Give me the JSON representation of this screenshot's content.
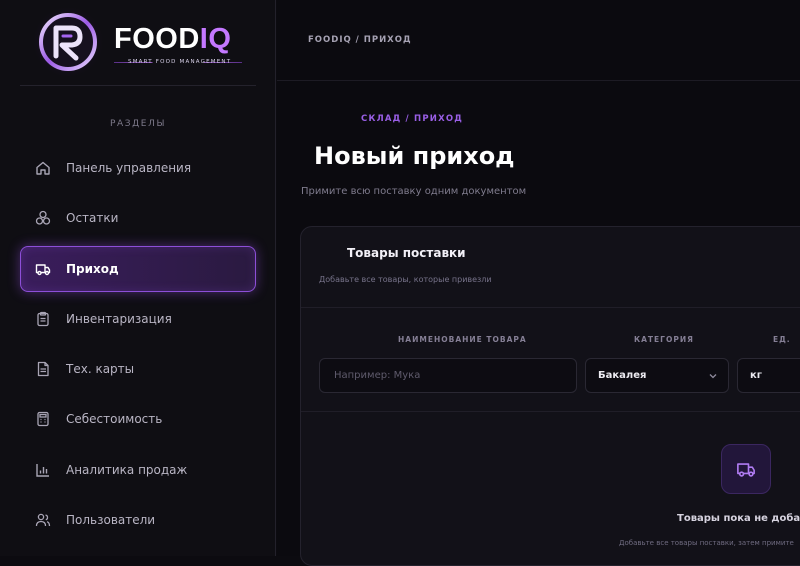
{
  "brand": {
    "name_main": "FOOD",
    "name_accent": "IQ",
    "tagline": "SMART FOOD MANAGEMENT",
    "accent_color": "#c478ff"
  },
  "sidebar": {
    "section_label": "РАЗДЕЛЫ",
    "items": [
      {
        "label": "Панель управления",
        "icon": "home-icon",
        "active": false
      },
      {
        "label": "Остатки",
        "icon": "boxes-icon",
        "active": false
      },
      {
        "label": "Приход",
        "icon": "truck-icon",
        "active": true
      },
      {
        "label": "Инвентаризация",
        "icon": "clipboard-icon",
        "active": false
      },
      {
        "label": "Тех. карты",
        "icon": "document-icon",
        "active": false
      },
      {
        "label": "Себестоимость",
        "icon": "calculator-icon",
        "active": false
      },
      {
        "label": "Аналитика продаж",
        "icon": "bar-chart-icon",
        "active": false
      },
      {
        "label": "Пользователи",
        "icon": "users-icon",
        "active": false
      }
    ]
  },
  "header": {
    "breadcrumb": "FOODIQ / ПРИХОД"
  },
  "page": {
    "kicker": "СКЛАД / ПРИХОД",
    "title": "Новый приход",
    "subtitle": "Примите всю поставку одним документом"
  },
  "card": {
    "title": "Товары поставки",
    "subtitle": "Добавьте все товары, которые привезли",
    "columns": {
      "name": "НАИМЕНОВАНИЕ ТОВАРА",
      "category": "КАТЕГОРИЯ",
      "unit": "ЕД."
    },
    "form": {
      "name_placeholder": "Например: Мука",
      "category_value": "Бакалея",
      "unit_value": "кг"
    },
    "empty": {
      "title": "Товары пока не добавле",
      "subtitle": "Добавьте все товары поставки, затем примите"
    }
  }
}
